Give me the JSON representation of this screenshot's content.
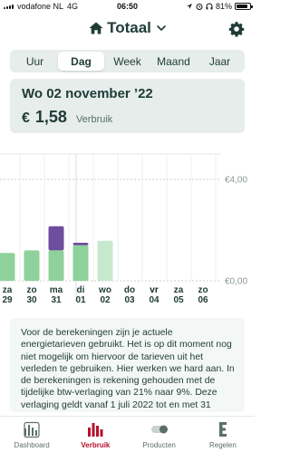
{
  "status_bar": {
    "carrier": "vodafone NL",
    "network": "4G",
    "time": "06:50",
    "battery": "81%"
  },
  "header": {
    "title": "Totaal"
  },
  "tabs": [
    {
      "label": "Uur",
      "active": false
    },
    {
      "label": "Dag",
      "active": true
    },
    {
      "label": "Week",
      "active": false
    },
    {
      "label": "Maand",
      "active": false
    },
    {
      "label": "Jaar",
      "active": false
    }
  ],
  "summary": {
    "date": "Wo 02 november ’22",
    "currency": "€",
    "amount": "1,58",
    "label": "Verbruik"
  },
  "chart_data": {
    "type": "bar",
    "categories": [
      {
        "day": "za",
        "date": "29",
        "bold": false
      },
      {
        "day": "zo",
        "date": "30",
        "bold": false
      },
      {
        "day": "ma",
        "date": "31",
        "bold": false
      },
      {
        "day": "di",
        "date": "01",
        "bold": false
      },
      {
        "day": "wo",
        "date": "02",
        "bold": false
      },
      {
        "day": "do",
        "date": "03",
        "bold": false
      },
      {
        "day": "vr",
        "date": "04",
        "bold": true
      },
      {
        "day": "za",
        "date": "05",
        "bold": false
      },
      {
        "day": "zo",
        "date": "06",
        "bold": false
      }
    ],
    "series": [
      {
        "values": [
          1.1,
          1.2,
          1.2,
          1.4,
          1.58,
          0,
          0,
          0,
          0
        ]
      },
      {
        "values": [
          0,
          0,
          0.95,
          0.1,
          0,
          0,
          0,
          0,
          0
        ]
      }
    ],
    "y_ticks": [
      "€4,00",
      "€0,00"
    ],
    "ylim": [
      0,
      5.0
    ],
    "colors": {
      "primary": "#8fd19a",
      "secondary": "#6e4d9c",
      "selected": "#c7e8cc"
    }
  },
  "info_text": "Voor de berekeningen zijn je actuele energietarieven gebruikt. Het is op dit moment nog niet mogelijk om hiervoor de tarieven uit het verleden te gebruiken. Hier werken we hard aan. In de berekeningen is rekening gehouden met de tijdelijke btw-verlaging van 21% naar 9%. Deze verlaging geldt vanaf 1 juli 2022 tot en met 31",
  "nav": [
    {
      "label": "Dashboard",
      "icon": "dashboard-icon",
      "active": false
    },
    {
      "label": "Verbruik",
      "icon": "bar-chart-icon",
      "active": true
    },
    {
      "label": "Producten",
      "icon": "toggle-icon",
      "active": false
    },
    {
      "label": "Regelen",
      "icon": "e-icon",
      "active": false
    }
  ],
  "colors": {
    "accent": "#b5122c",
    "text": "#1f3b35",
    "card": "#e6edeb"
  }
}
